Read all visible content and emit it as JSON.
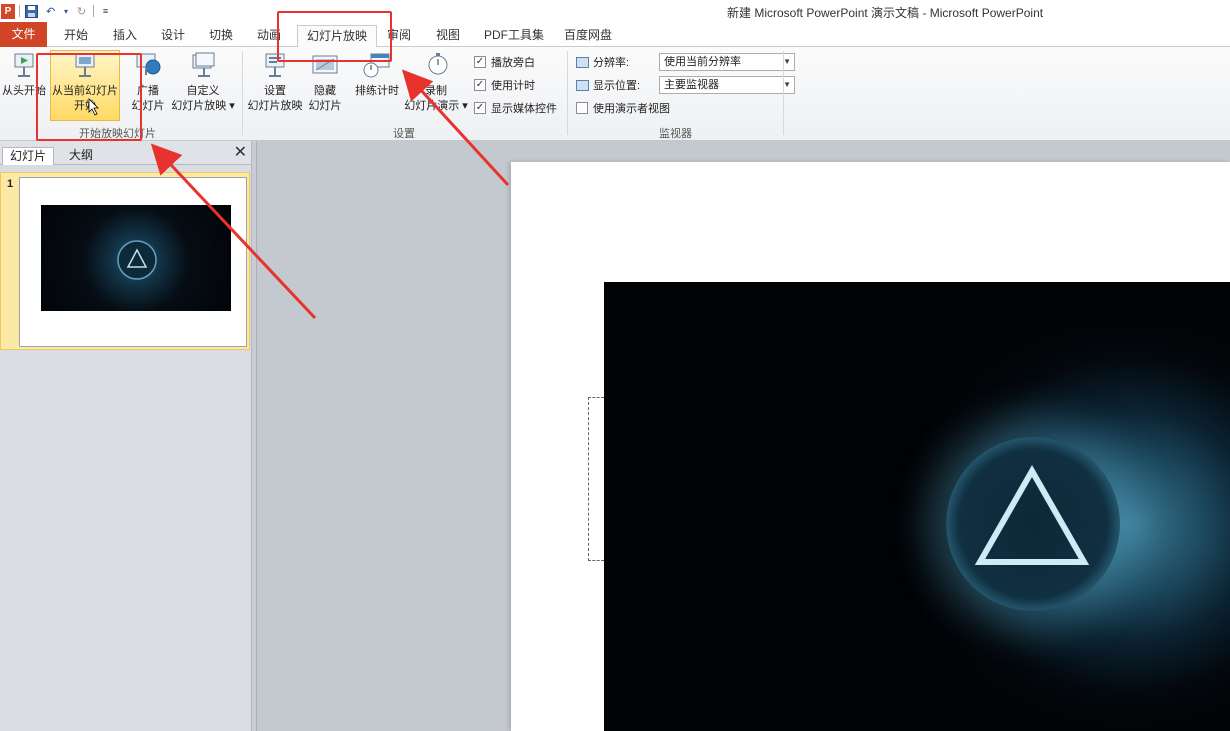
{
  "app": {
    "window_title": "新建 Microsoft PowerPoint 演示文稿 - Microsoft PowerPoint",
    "logo": "P"
  },
  "ribbon_tabs": {
    "file": "文件",
    "home": "开始",
    "insert": "插入",
    "design": "设计",
    "transitions": "切换",
    "animations": "动画",
    "slideshow": "幻灯片放映",
    "review": "审阅",
    "view": "视图",
    "pdf": "PDF工具集",
    "baidu": "百度网盘"
  },
  "groups": {
    "start": {
      "label": "开始放映幻灯片",
      "from_beginning": "从头开始",
      "from_current_1": "从当前幻灯片",
      "from_current_2": "开始",
      "broadcast_1": "广播",
      "broadcast_2": "幻灯片",
      "custom_1": "自定义",
      "custom_2": "幻灯片放映 ▾"
    },
    "setup": {
      "label": "设置",
      "setup_1": "设置",
      "setup_2": "幻灯片放映",
      "hide_1": "隐藏",
      "hide_2": "幻灯片",
      "rehearse": "排练计时",
      "record_1": "录制",
      "record_2": "幻灯片演示 ▾",
      "chk_narration": "播放旁白",
      "chk_timings": "使用计时",
      "chk_media": "显示媒体控件"
    },
    "monitors": {
      "label": "监视器",
      "resolution_label": "分辨率:",
      "resolution_value": "使用当前分辨率",
      "show_on_label": "显示位置:",
      "show_on_value": "主要监视器",
      "presenter_view": "使用演示者视图"
    }
  },
  "panel": {
    "tab_slides": "幻灯片",
    "tab_outline": "大纲",
    "close": "✕",
    "slide_number": "1"
  },
  "colors": {
    "file_tab": "#d04525",
    "highlight": "#ffd964",
    "annotation": "#e8322d"
  }
}
